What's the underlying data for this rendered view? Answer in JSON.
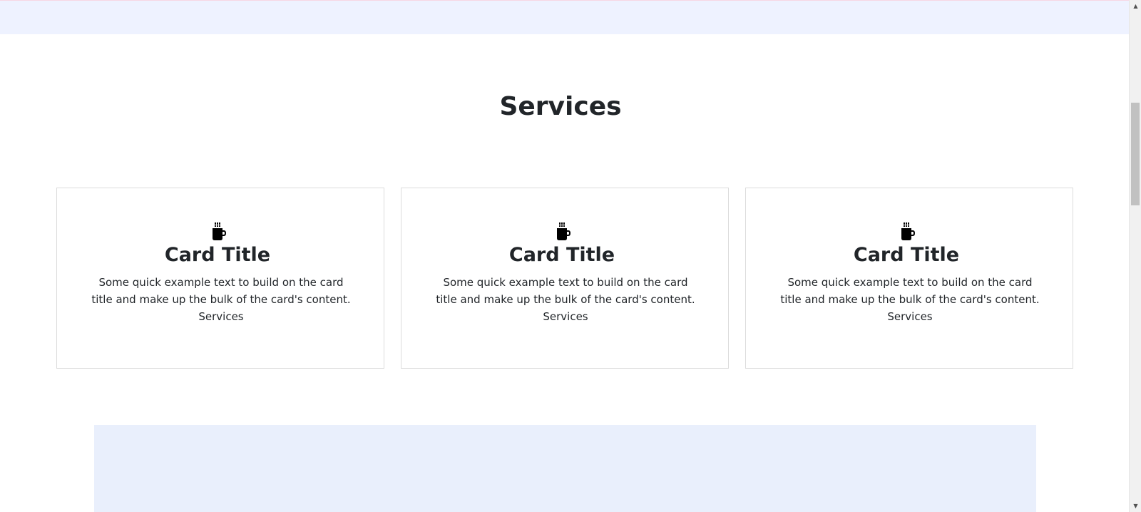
{
  "section": {
    "title": "Services"
  },
  "cards": [
    {
      "icon": "coffee-cup-icon",
      "title": "Card Title",
      "text": "Some quick example text to build on the card title and make up the bulk of the card's content.",
      "note": "Services"
    },
    {
      "icon": "coffee-cup-icon",
      "title": "Card Title",
      "text": "Some quick example text to build on the card title and make up the bulk of the card's content.",
      "note": "Services"
    },
    {
      "icon": "coffee-cup-icon",
      "title": "Card Title",
      "text": "Some quick example text to build on the card title and make up the bulk of the card's content.",
      "note": "Services"
    }
  ],
  "scrollbar": {
    "up_arrow": "▲",
    "down_arrow": "▼"
  },
  "colors": {
    "top_band": "#eef2ff",
    "bottom_band": "#e9effc",
    "text": "#212529",
    "card_border": "#dcdcdc"
  }
}
